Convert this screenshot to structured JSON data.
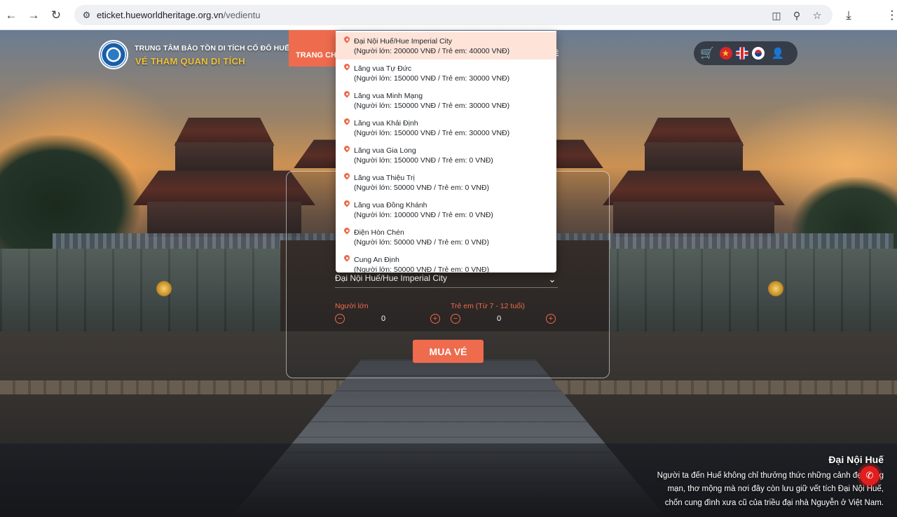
{
  "browser": {
    "url_host": "eticket.hueworldheritage.org.vn",
    "url_path": "/vedientu"
  },
  "header": {
    "org_name": "TRUNG TÂM BẢO TỒN DI TÍCH CỐ ĐÔ HUẾ",
    "subtitle": "VÉ THAM QUAN DI TÍCH",
    "nav_home": "TRANG CH",
    "nav_other": "Ê"
  },
  "booking": {
    "selected_site": "Đại Nội Huế/Hue Imperial City",
    "adult_label": "Người lớn",
    "child_label": "Trẻ em (Từ 7 - 12 tuổi)",
    "adult_qty": "0",
    "child_qty": "0",
    "buy_label": "MUA VÉ"
  },
  "dropdown": {
    "items": [
      {
        "name": "Đại Nội Huế/Hue Imperial City",
        "price": "(Người lớn: 200000 VNĐ / Trẻ em: 40000 VNĐ)",
        "selected": true
      },
      {
        "name": "Lăng vua Tự Đức",
        "price": "(Người lớn: 150000 VNĐ / Trẻ em: 30000 VNĐ)"
      },
      {
        "name": "Lăng vua Minh Mạng",
        "price": "(Người lớn: 150000 VNĐ / Trẻ em: 30000 VNĐ)"
      },
      {
        "name": "Lăng vua Khải Định",
        "price": "(Người lớn: 150000 VNĐ / Trẻ em: 30000 VNĐ)"
      },
      {
        "name": "Lăng vua Gia Long",
        "price": "(Người lớn: 150000 VNĐ / Trẻ em: 0 VNĐ)"
      },
      {
        "name": "Lăng vua Thiệu Trị",
        "price": "(Người lớn: 50000 VNĐ / Trẻ em: 0 VNĐ)"
      },
      {
        "name": "Lăng vua Đồng Khánh",
        "price": "(Người lớn: 100000 VNĐ / Trẻ em: 0 VNĐ)"
      },
      {
        "name": "Điện Hòn Chén",
        "price": "(Người lớn: 50000 VNĐ / Trẻ em: 0 VNĐ)"
      },
      {
        "name": "Cung An Định",
        "price": "(Người lớn: 50000 VNĐ / Trẻ em: 0 VNĐ)"
      }
    ]
  },
  "caption": {
    "title": "Đại Nội Huế",
    "lines": [
      "Người ta đến Huế không chỉ thưởng thức những cảnh đẹp lãng",
      "mạn, thơ mộng mà nơi đây còn lưu giữ vết tích Đại Nội Huế,",
      "chốn cung đình xưa cũ của triều đại nhà Nguyễn ở Việt Nam."
    ]
  },
  "colors": {
    "accent": "#ee6b4d",
    "brand_gold": "#f2c23b",
    "call": "#e11d1d"
  },
  "icons": {
    "back": "arrow-left-icon",
    "forward": "arrow-right-icon",
    "reload": "reload-icon",
    "cart": "cart-icon",
    "user": "user-icon",
    "call": "phone-icon"
  }
}
